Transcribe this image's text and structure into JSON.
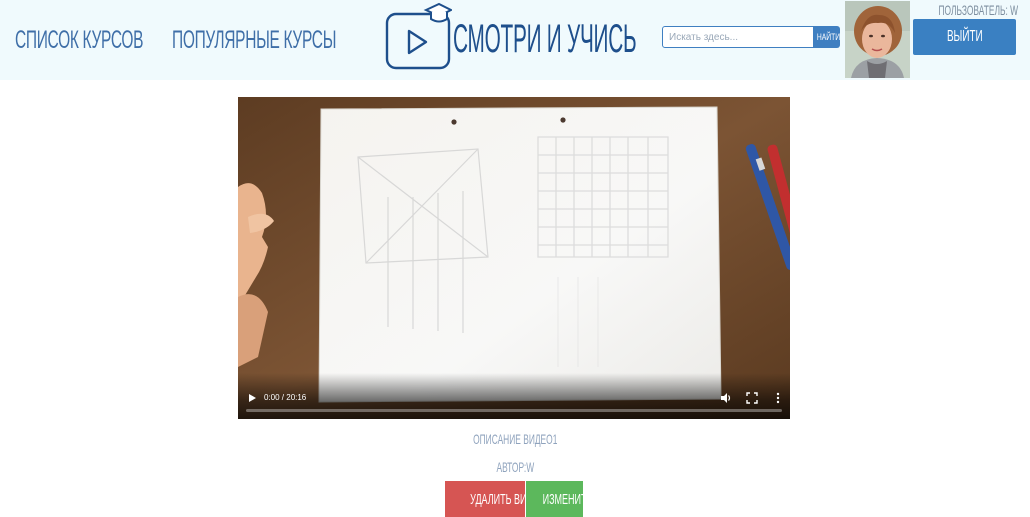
{
  "header": {
    "nav": {
      "course_list": "Список курсов",
      "popular_courses": "Популярные курсы"
    },
    "brand": "Смотри и учись",
    "search": {
      "placeholder": "Искать здесь...",
      "button": "Найти"
    },
    "user_label": "Пользователь: W",
    "logout": "Выйти"
  },
  "video": {
    "time": "0:00 / 20:16",
    "progress": 0
  },
  "details": {
    "description": "Описание видео1",
    "author": "Автор:W"
  },
  "actions": {
    "delete": "Удалить видео",
    "edit": "Изменить"
  },
  "colors": {
    "header_bg": "#f0fafd",
    "accent": "#3a80c2",
    "danger": "#d65553",
    "success": "#5cb85c"
  },
  "icons": {
    "logo": "play-screen-graduation-cap-icon",
    "play": "play-icon",
    "volume": "volume-icon",
    "fullscreen": "fullscreen-icon",
    "more": "more-vertical-icon"
  }
}
